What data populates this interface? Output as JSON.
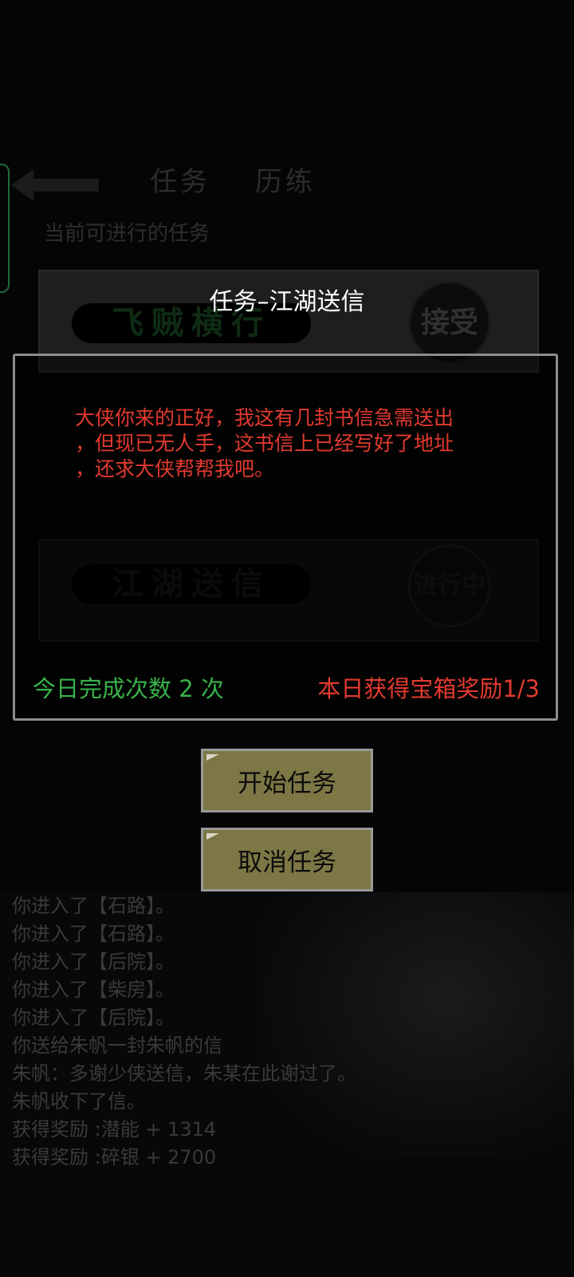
{
  "background": {
    "tabs": [
      "任务",
      "历练"
    ],
    "section_label": "当前可进行的任务",
    "tasks": [
      {
        "name": "飞贼横行",
        "action": "接受"
      },
      {
        "name": "江湖送信",
        "action": "进行中"
      }
    ],
    "log": [
      "你进入了【石路】。",
      "你进入了【石路】。",
      "你进入了【后院】。",
      "你进入了【柴房】。",
      "你进入了【后院】。",
      "你送给朱帆一封朱帆的信",
      "朱帆：多谢少侠送信，朱某在此谢过了。",
      "朱帆收下了信。",
      "获得奖励 :潜能 + 1314",
      "获得奖励 :碎银 + 2700"
    ]
  },
  "dialog": {
    "title": "任务–江湖送信",
    "message": "大侠你来的正好，我这有几封书信急需送出\n，但现已无人手，这书信上已经写好了地址\n，还求大侠帮帮我吧。",
    "completion_count": "今日完成次数 2 次",
    "reward_progress": "本日获得宝箱奖励1/3",
    "start_button": "开始任务",
    "cancel_button": "取消任务"
  },
  "colors": {
    "message_red": "#e23a30",
    "count_green": "#38b24a",
    "button_olive": "#7c7745"
  }
}
